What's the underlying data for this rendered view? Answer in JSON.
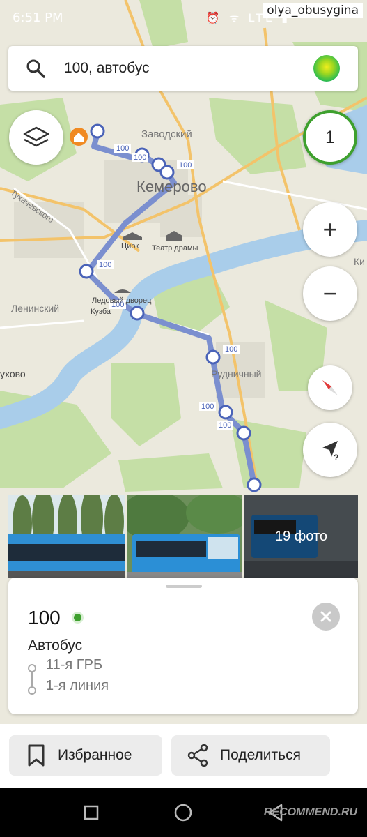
{
  "status_bar": {
    "time": "6:51 PM",
    "icons": "⏰ ᯤ LTE ▮",
    "watermark_user": "olya_obusygina"
  },
  "search": {
    "query": "100, автобус",
    "icon": "search-icon"
  },
  "map": {
    "labels": {
      "zavodsky": "Заводский",
      "kemerovo": "Кемерово",
      "tukhachevsky": "Тухачевского",
      "tsirk": "Цирк",
      "teatr": "Театр драмы",
      "leninsky": "Ленинский",
      "ledovy": "Ледовый дворец",
      "kuzbass": "Кузба",
      "rudnichny": "Рудничный",
      "ukhovo": "ухово",
      "ki": "Ки"
    },
    "route_label": "100",
    "route_color": "#7b8fcf"
  },
  "controls": {
    "layers_icon": "layers-icon",
    "counter": "1",
    "zoom_in": "+",
    "zoom_out": "−",
    "compass_icon": "compass-icon",
    "locate_icon": "locate-question-icon"
  },
  "photos": {
    "more_label": "19 фото"
  },
  "card": {
    "route_number": "100",
    "type": "Автобус",
    "from": "11-я ГРБ",
    "to": "1-я линия",
    "status_color": "#3ea02e"
  },
  "actions": {
    "favorite": "Избранное",
    "share": "Поделиться"
  },
  "navbar": {
    "brand": "RECOMMEND.RU"
  }
}
